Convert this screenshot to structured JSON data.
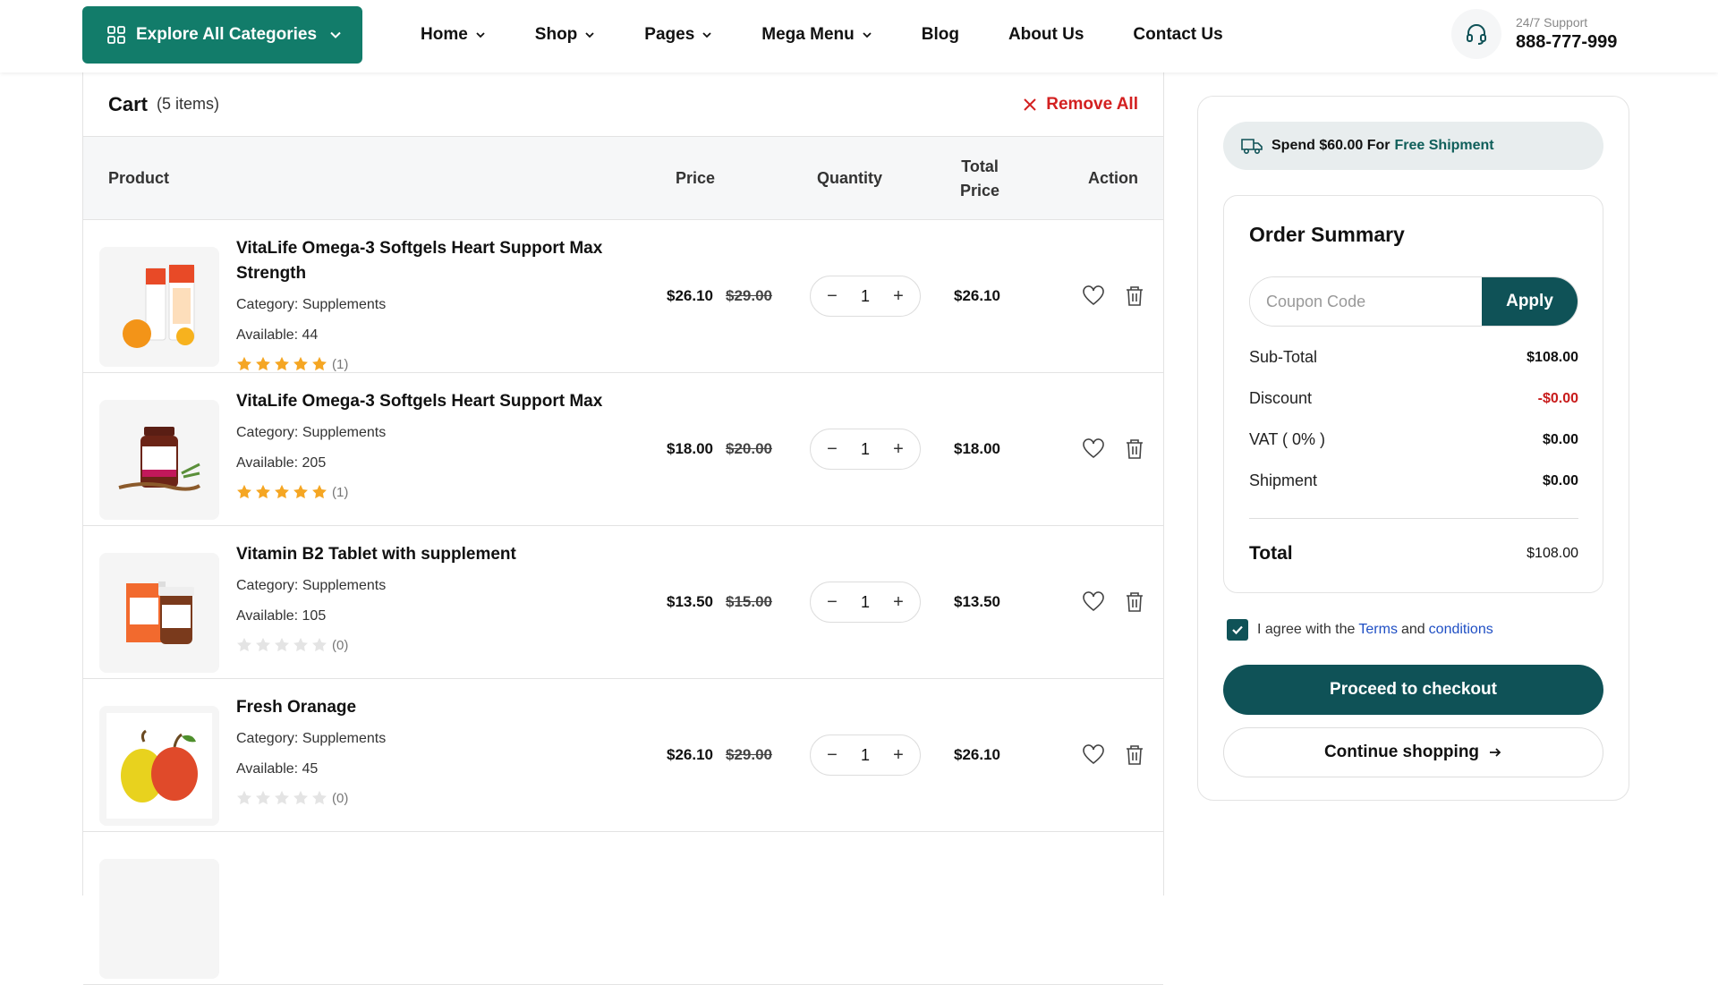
{
  "header": {
    "explore_label": "Explore All Categories",
    "nav": [
      {
        "label": "Home"
      },
      {
        "label": "Shop"
      },
      {
        "label": "Pages"
      },
      {
        "label": "Mega Menu"
      },
      {
        "label": "Blog"
      },
      {
        "label": "About Us"
      },
      {
        "label": "Contact Us"
      }
    ],
    "support_label": "24/7 Support",
    "support_phone": "888-777-999",
    "accent_color": "#127c6a"
  },
  "cart": {
    "title": "Cart",
    "count": "(5 items)",
    "remove_all": "Remove All",
    "columns": {
      "product": "Product",
      "price": "Price",
      "quantity": "Quantity",
      "total_price_1": "Total",
      "total_price_2": "Price",
      "action": "Action"
    },
    "items": [
      {
        "name_line1": "VitaLife Omega-3 Softgels Heart Support Max",
        "name_line2": "Strength",
        "category": "Category: Supplements",
        "available": "Available: 44",
        "rating": 5,
        "reviews": "(1)",
        "price": "$26.10",
        "old_price": "$29.00",
        "qty": "1",
        "total": "$26.10",
        "image": "vitamin-c-tube"
      },
      {
        "name_line1": "VitaLife Omega-3 Softgels Heart Support Max",
        "name_line2": "",
        "category": "Category: Supplements",
        "available": "Available: 205",
        "rating": 5,
        "reviews": "(1)",
        "price": "$18.00",
        "old_price": "$20.00",
        "qty": "1",
        "total": "$18.00",
        "image": "neem-bottle"
      },
      {
        "name_line1": "Vitamin B2 Tablet with supplement",
        "name_line2": "",
        "category": "Category: Supplements",
        "available": "Available: 105",
        "rating": 0,
        "reviews": "(0)",
        "price": "$13.50",
        "old_price": "$15.00",
        "qty": "1",
        "total": "$13.50",
        "image": "vitamin-b12-box"
      },
      {
        "name_line1": "Fresh Oranage",
        "name_line2": "",
        "category": "Category: Supplements",
        "available": "Available: 45",
        "rating": 0,
        "reviews": "(0)",
        "price": "$26.10",
        "old_price": "$29.00",
        "qty": "1",
        "total": "$26.10",
        "image": "pears"
      }
    ]
  },
  "sidebar": {
    "free_ship_prefix": "Spend $60.00 For",
    "free_ship_accent": "Free Shipment",
    "summary_title": "Order Summary",
    "coupon_placeholder": "Coupon Code",
    "apply_label": "Apply",
    "rows": [
      {
        "label": "Sub-Total",
        "value": "$108.00"
      },
      {
        "label": "Discount",
        "value": "-$0.00"
      },
      {
        "label": "VAT ( 0% )",
        "value": "$0.00"
      },
      {
        "label": "Shipment",
        "value": "$0.00"
      }
    ],
    "total_label": "Total",
    "total_value": "$108.00",
    "agree_text": "I agree with the",
    "terms": "Terms",
    "and": "and",
    "conditions": "conditions",
    "agreed": true,
    "checkout_label": "Proceed to checkout",
    "continue_label": "Continue shopping",
    "primary_color": "#0f5257",
    "discount_color": "#c81b1b"
  }
}
